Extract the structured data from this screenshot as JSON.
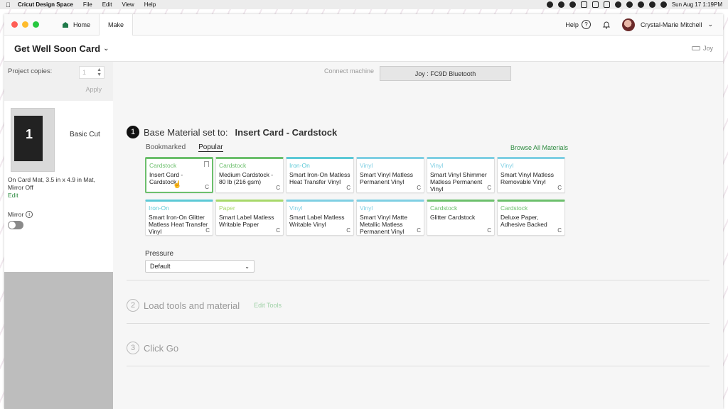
{
  "menubar": {
    "app_name": "Cricut Design Space",
    "menus": [
      "File",
      "Edit",
      "View",
      "Help"
    ],
    "datetime": "Sun Aug 17  1:19PM"
  },
  "titlebar": {
    "home_tab": "Home",
    "make_tab": "Make",
    "help": "Help",
    "help_icon_glyph": "?",
    "user_name": "Crystal-Marie Mitchell"
  },
  "project": {
    "title": "Get Well Soon Card",
    "machine_short": "Joy"
  },
  "sidebar": {
    "copies_label": "Project copies:",
    "copies_value": "1",
    "apply_label": "Apply",
    "mat_number": "1",
    "mat_label": "Basic Cut",
    "mat_info": "On Card Mat, 3.5 in x 4.9 in Mat, Mirror Off",
    "edit_label": "Edit",
    "mirror_label": "Mirror",
    "mirror_on": false
  },
  "main": {
    "connect_label": "Connect machine",
    "machine_button": "Joy : FC9D Bluetooth",
    "step1": {
      "num": "1",
      "label": "Base Material set to:",
      "value": "Insert Card - Cardstock"
    },
    "material_tabs": [
      "Bookmarked",
      "Popular"
    ],
    "active_material_tab": "Popular",
    "browse_all": "Browse All Materials",
    "materials": [
      {
        "category": "Cardstock",
        "name": "Insert Card - Cardstock",
        "color": "#6cbf6c",
        "selected": true
      },
      {
        "category": "Cardstock",
        "name": "Medium Cardstock - 80 lb (216 gsm)",
        "color": "#6cbf6c"
      },
      {
        "category": "Iron-On",
        "name": "Smart Iron-On Matless Heat Transfer Vinyl",
        "color": "#5cc9d6"
      },
      {
        "category": "Vinyl",
        "name": "Smart Vinyl Matless Permanent Vinyl",
        "color": "#7fcfe3"
      },
      {
        "category": "Vinyl",
        "name": "Smart Vinyl Shimmer Matless Permanent Vinyl",
        "color": "#7fcfe3"
      },
      {
        "category": "Vinyl",
        "name": "Smart Vinyl Matless Removable Vinyl",
        "color": "#7fcfe3"
      },
      {
        "category": "Iron-On",
        "name": "Smart Iron-On Glitter Matless Heat Transfer Vinyl",
        "color": "#5cc9d6"
      },
      {
        "category": "Paper",
        "name": "Smart Label Matless Writable Paper",
        "color": "#a8d86a"
      },
      {
        "category": "Vinyl",
        "name": "Smart Label Matless Writable Vinyl",
        "color": "#7fcfe3"
      },
      {
        "category": "Vinyl",
        "name": "Smart Vinyl Matte Metallic Matless Permanent Vinyl",
        "color": "#7fcfe3"
      },
      {
        "category": "Cardstock",
        "name": "Glitter Cardstock",
        "color": "#6cbf6c"
      },
      {
        "category": "Cardstock",
        "name": "Deluxe Paper, Adhesive Backed",
        "color": "#6cbf6c"
      }
    ],
    "pressure_label": "Pressure",
    "pressure_value": "Default",
    "step2": {
      "num": "2",
      "label": "Load tools and material",
      "edit_tools": "Edit Tools"
    },
    "step3": {
      "num": "3",
      "label": "Click Go"
    }
  }
}
